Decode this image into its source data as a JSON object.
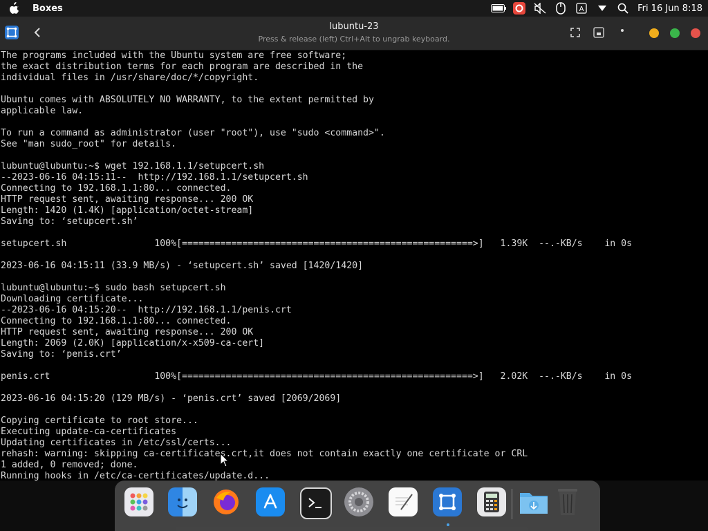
{
  "topbar": {
    "app_name": "Boxes",
    "clock": "Fri 16 Jun 8:18",
    "icons": [
      "apple-logo",
      "battery-icon",
      "notification-app-icon",
      "mute-icon",
      "mouse-icon",
      "input-method-icon",
      "dropdown-icon",
      "search-icon"
    ]
  },
  "window": {
    "title": "lubuntu-23",
    "subtitle": "Press & release (left) Ctrl+Alt to ungrab keyboard.",
    "icons": [
      "boxes-app-icon",
      "back-icon",
      "fullscreen-icon",
      "keyboard-icon",
      "menu-dots-icon"
    ],
    "traffic_colors": [
      "#f0ad1c",
      "#3ab54a",
      "#e5534b"
    ]
  },
  "terminal": {
    "lines": [
      "The programs included with the Ubuntu system are free software;",
      "the exact distribution terms for each program are described in the",
      "individual files in /usr/share/doc/*/copyright.",
      "",
      "Ubuntu comes with ABSOLUTELY NO WARRANTY, to the extent permitted by",
      "applicable law.",
      "",
      "To run a command as administrator (user \"root\"), use \"sudo <command>\".",
      "See \"man sudo_root\" for details.",
      "",
      "lubuntu@lubuntu:~$ wget 192.168.1.1/setupcert.sh",
      "--2023-06-16 04:15:11--  http://192.168.1.1/setupcert.sh",
      "Connecting to 192.168.1.1:80... connected.",
      "HTTP request sent, awaiting response... 200 OK",
      "Length: 1420 (1.4K) [application/octet-stream]",
      "Saving to: ‘setupcert.sh’",
      "",
      "setupcert.sh                100%[=====================================================>]   1.39K  --.-KB/s    in 0s",
      "",
      "2023-06-16 04:15:11 (33.9 MB/s) - ‘setupcert.sh’ saved [1420/1420]",
      "",
      "lubuntu@lubuntu:~$ sudo bash setupcert.sh",
      "Downloading certificate...",
      "--2023-06-16 04:15:20--  http://192.168.1.1/penis.crt",
      "Connecting to 192.168.1.1:80... connected.",
      "HTTP request sent, awaiting response... 200 OK",
      "Length: 2069 (2.0K) [application/x-x509-ca-cert]",
      "Saving to: ‘penis.crt’",
      "",
      "penis.crt                   100%[=====================================================>]   2.02K  --.-KB/s    in 0s",
      "",
      "2023-06-16 04:15:20 (129 MB/s) - ‘penis.crt’ saved [2069/2069]",
      "",
      "Copying certificate to root store...",
      "Executing update-ca-certificates",
      "Updating certificates in /etc/ssl/certs...",
      "rehash: warning: skipping ca-certificates.crt,it does not contain exactly one certificate or CRL",
      "1 added, 0 removed; done.",
      "Running hooks in /etc/ca-certificates/update.d..."
    ]
  },
  "dock": {
    "apps": [
      "launchpad-icon",
      "finder-icon",
      "firefox-icon",
      "app-store-icon",
      "terminal-icon",
      "system-settings-icon",
      "text-editor-icon",
      "boxes-icon",
      "calculator-icon",
      "downloads-folder-icon",
      "trash-icon"
    ]
  }
}
